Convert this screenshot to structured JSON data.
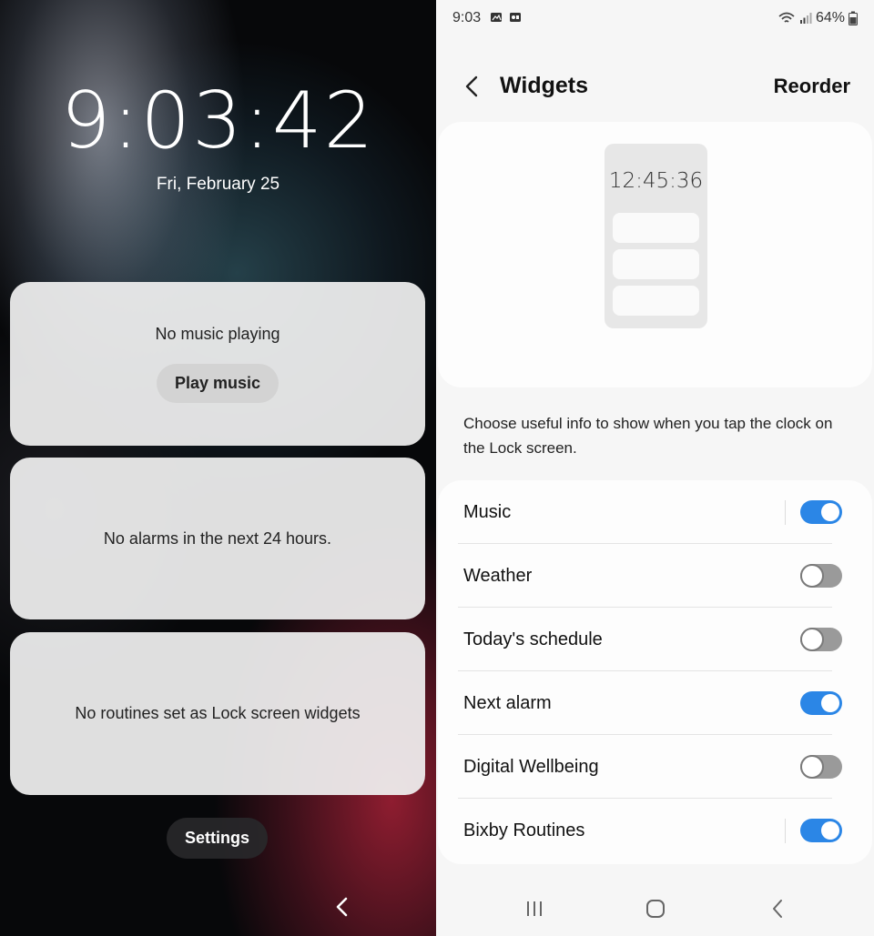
{
  "lock_screen": {
    "time": "9:03:42",
    "date": "Fri, February 25",
    "music_card": {
      "message": "No music playing",
      "button_label": "Play music"
    },
    "alarm_card": {
      "message": "No alarms in the next 24 hours."
    },
    "routines_card": {
      "message": "No routines set as Lock screen widgets"
    },
    "settings_button_label": "Settings",
    "nav": {
      "icon": "back-icon"
    }
  },
  "settings_screen": {
    "status_bar": {
      "time": "9:03",
      "battery": "64%",
      "icons": [
        "gallery-icon",
        "screen-record-icon",
        "wifi-icon",
        "signal-icon",
        "battery-icon"
      ]
    },
    "header": {
      "title": "Widgets",
      "reorder_label": "Reorder",
      "back_icon": "back-icon"
    },
    "preview": {
      "time": "12:45:36"
    },
    "description": "Choose useful info to show when you tap the clock on the Lock screen.",
    "widgets": [
      {
        "label": "Music",
        "enabled": true,
        "has_divider_line": true
      },
      {
        "label": "Weather",
        "enabled": false,
        "has_divider_line": false
      },
      {
        "label": "Today's schedule",
        "enabled": false,
        "has_divider_line": false
      },
      {
        "label": "Next alarm",
        "enabled": true,
        "has_divider_line": false
      },
      {
        "label": "Digital Wellbeing",
        "enabled": false,
        "has_divider_line": false
      },
      {
        "label": "Bixby Routines",
        "enabled": true,
        "has_divider_line": true
      }
    ],
    "nav_bar": {
      "items": [
        "recents-icon",
        "home-icon",
        "back-icon"
      ]
    }
  },
  "colors": {
    "accent": "#2b86e6",
    "background": "#f6f6f6",
    "card": "#fdfdfd"
  }
}
